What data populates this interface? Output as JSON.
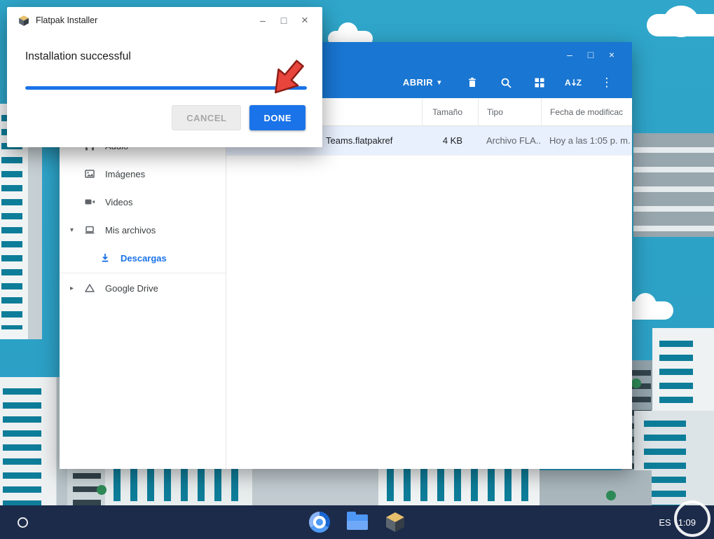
{
  "colors": {
    "accent": "#1a73e8",
    "files-header": "#1976d2",
    "sky": "#2fa6ca",
    "shelf": "#1c2b4a",
    "selection": "#e8f0fe",
    "arrow": "#e8453c",
    "arrow-outline": "#8f1d18"
  },
  "icons": {
    "minimize": "–",
    "maximize": "□",
    "close": "×",
    "caret_down": "▾",
    "chevron_down": "▾",
    "chevron_right": "▸",
    "kebab": "⋮"
  },
  "dialog": {
    "title": "Flatpak Installer",
    "message": "Installation successful",
    "progress_percent": 100,
    "cancel_label": "CANCEL",
    "done_label": "DONE"
  },
  "files_app": {
    "toolbar": {
      "open_label": "ABRIR",
      "sort_a": "A",
      "sort_z": "Z"
    },
    "columns": [
      "Tamaño",
      "Tipo",
      "Fecha de modificac"
    ],
    "sidebar": [
      {
        "label": "Audio"
      },
      {
        "label": "Imágenes"
      },
      {
        "label": "Videos"
      },
      {
        "label": "Mis archivos"
      },
      {
        "label": "Descargas"
      },
      {
        "label": "Google Drive"
      }
    ],
    "file": {
      "name": "Teams.flatpakref",
      "size": "4 KB",
      "type": "Archivo FLA...",
      "modified": "Hoy a las 1:05 p. m."
    }
  },
  "shelf": {
    "language": "ES",
    "time": "1:09"
  }
}
